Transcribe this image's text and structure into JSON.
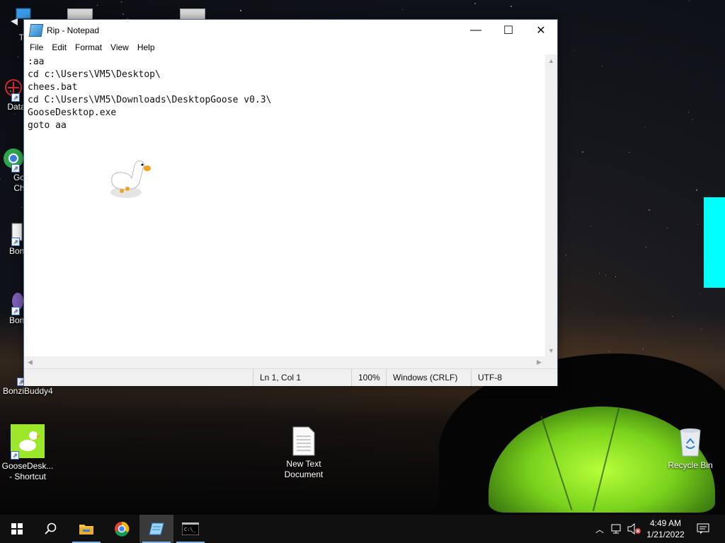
{
  "notepad": {
    "title": "Rip - Notepad",
    "menu": [
      "File",
      "Edit",
      "Format",
      "View",
      "Help"
    ],
    "lines": [
      ":aa",
      "cd c:\\Users\\VM5\\Desktop\\",
      "chees.bat",
      "cd C:\\Users\\VM5\\Downloads\\DesktopGoose v0.3\\",
      "GooseDesktop.exe",
      "goto aa"
    ],
    "status": {
      "position": "Ln 1, Col 1",
      "zoom": "100%",
      "line_ending": "Windows (CRLF)",
      "encoding": "UTF-8"
    },
    "controls": {
      "minimize": "—",
      "maximize": "☐",
      "close": "✕"
    }
  },
  "desktop_icons": {
    "this_pc": "Thi",
    "data": "DataV",
    "chrome_line1": "Go",
    "chrome_line2": "Ch",
    "bonzi1": "Bonzi",
    "bonzi2": "Bonzi",
    "bonzibuddy4": "BonziBuddy4",
    "goose_line1": "GooseDesk...",
    "goose_line2": "- Shortcut",
    "new_text_line1": "New Text",
    "new_text_line2": "Document",
    "recycle_bin": "Recycle Bin"
  },
  "taskbar": {
    "time": "4:49 AM",
    "date": "1/21/2022",
    "pinned": [
      "start-icon",
      "search-icon",
      "file-explorer-icon",
      "chrome-icon",
      "notepad-icon",
      "cmd-icon"
    ]
  },
  "colors": {
    "accent": "#7fb4ea",
    "cyan_overlay": "#00ffff",
    "tent_green": "#9be82b",
    "taskbar": "#101010"
  }
}
